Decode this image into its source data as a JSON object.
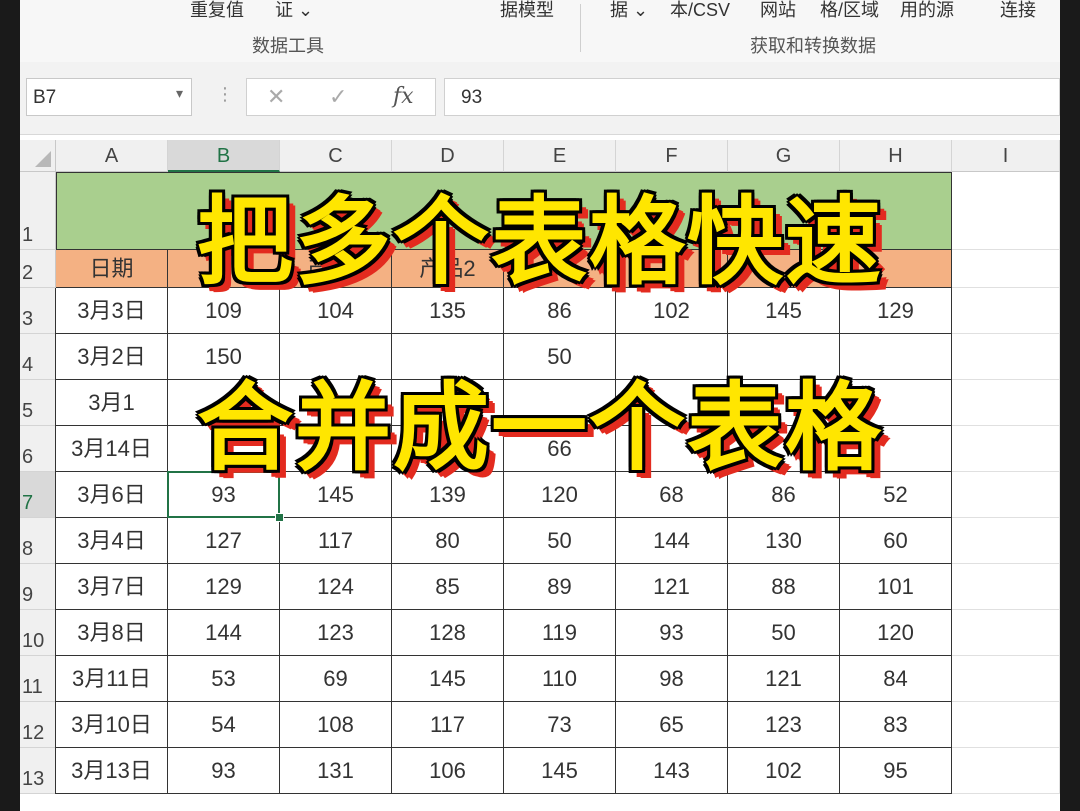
{
  "ribbon": {
    "items": [
      "重复值",
      "证 ⌄",
      "据模型",
      "据 ⌄",
      "本/CSV",
      "网站",
      "格/区域",
      "用的源",
      "连接"
    ],
    "groups": [
      "数据工具",
      "获取和转换数据"
    ]
  },
  "formula_bar": {
    "name_box": "B7",
    "cancel_icon": "✕",
    "enter_icon": "✓",
    "fx_label": "fx",
    "value": "93"
  },
  "columns": [
    "A",
    "B",
    "C",
    "D",
    "E",
    "F",
    "G",
    "H",
    "I"
  ],
  "rows": [
    {
      "num": "1",
      "cells": [
        "",
        "",
        "",
        "",
        "",
        "",
        "",
        ""
      ]
    },
    {
      "num": "2",
      "cells": [
        "日期",
        "",
        "产品3",
        "产品2",
        "",
        "",
        "",
        ""
      ]
    },
    {
      "num": "3",
      "cells": [
        "3月3日",
        "109",
        "104",
        "135",
        "86",
        "102",
        "145",
        "129"
      ]
    },
    {
      "num": "4",
      "cells": [
        "3月2日",
        "150",
        "",
        "",
        "50",
        "",
        "",
        ""
      ]
    },
    {
      "num": "5",
      "cells": [
        "3月1",
        "",
        "",
        "",
        "",
        "",
        "",
        ""
      ]
    },
    {
      "num": "6",
      "cells": [
        "3月14日",
        "",
        "",
        "",
        "66",
        "",
        "",
        ""
      ]
    },
    {
      "num": "7",
      "cells": [
        "3月6日",
        "93",
        "145",
        "139",
        "120",
        "68",
        "86",
        "52"
      ]
    },
    {
      "num": "8",
      "cells": [
        "3月4日",
        "127",
        "117",
        "80",
        "50",
        "144",
        "130",
        "60"
      ]
    },
    {
      "num": "9",
      "cells": [
        "3月7日",
        "129",
        "124",
        "85",
        "89",
        "121",
        "88",
        "101"
      ]
    },
    {
      "num": "10",
      "cells": [
        "3月8日",
        "144",
        "123",
        "128",
        "119",
        "93",
        "50",
        "120"
      ]
    },
    {
      "num": "11",
      "cells": [
        "3月11日",
        "53",
        "69",
        "145",
        "110",
        "98",
        "121",
        "84"
      ]
    },
    {
      "num": "12",
      "cells": [
        "3月10日",
        "54",
        "108",
        "117",
        "73",
        "65",
        "123",
        "83"
      ]
    },
    {
      "num": "13",
      "cells": [
        "3月13日",
        "93",
        "131",
        "106",
        "145",
        "143",
        "102",
        "95"
      ]
    }
  ],
  "selected_cell": "B7",
  "overlay": {
    "line1": "把多个表格快速",
    "line2": "合并成一个表格"
  },
  "colors": {
    "title_fill": "#a9cf8e",
    "header_fill": "#f4b183",
    "selection": "#217346",
    "overlay_text": "#ffe600",
    "overlay_shadow": "#e32b1f"
  }
}
